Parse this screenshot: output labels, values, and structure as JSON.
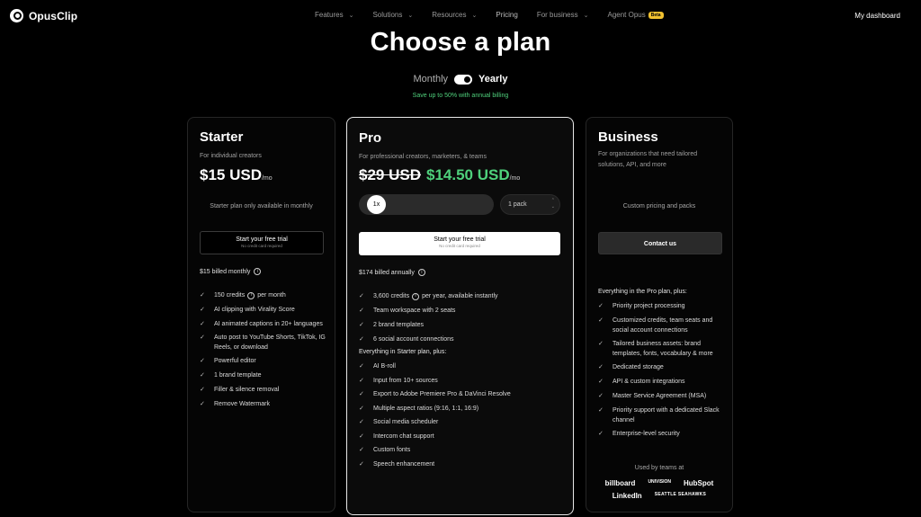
{
  "nav": {
    "logo_text": "OpusClip",
    "items": [
      {
        "label": "Features"
      },
      {
        "label": "Solutions"
      },
      {
        "label": "Resources"
      },
      {
        "label": "Pricing"
      },
      {
        "label": "For business"
      },
      {
        "label": "Agent Opus",
        "badge": "Beta"
      }
    ],
    "dashboard": "My dashboard"
  },
  "hero": {
    "title": "Choose a plan",
    "monthly": "Monthly",
    "yearly": "Yearly",
    "save_note": "Save up to 50% with annual billing"
  },
  "starter": {
    "name": "Starter",
    "subtitle": "For individual creators",
    "price": "$15 USD",
    "per": "/mo",
    "note": "Starter plan only available in monthly",
    "cta": "Start your free trial",
    "cta_sub": "No credit card required",
    "billed": "$15 billed monthly",
    "features": [
      "150 credits",
      "per month",
      "AI clipping with Virality Score",
      "AI animated captions in 20+ languages",
      "Auto post to YouTube Shorts, TikTok, IG Reels, or download",
      "Powerful editor",
      "1 brand template",
      "Filler & silence removal",
      "Remove Watermark"
    ]
  },
  "pro": {
    "name": "Pro",
    "subtitle": "For professional creators, marketers, & teams",
    "old_price": "$29 USD",
    "price": "$14.50 USD",
    "per": "/mo",
    "multiplier": "1x",
    "pack": "1 pack",
    "cta": "Start your free trial",
    "cta_sub": "No credit card required",
    "billed": "$174 billed annually",
    "features": [
      "3,600 credits",
      "per year, available instantly",
      "Team workspace with 2 seats",
      "2 brand templates",
      "6 social account connections"
    ],
    "plus_label": "Everything in Starter plan, plus:",
    "plus_features": [
      "AI B-roll",
      "Input from 10+ sources",
      "Export to Adobe Premiere Pro & DaVinci Resolve",
      "Multiple aspect ratios (9:16, 1:1, 16:9)",
      "Social media scheduler",
      "Intercom chat support",
      "Custom fonts",
      "Speech enhancement"
    ]
  },
  "business": {
    "name": "Business",
    "subtitle": "For organizations that need tailored solutions, API, and more",
    "note": "Custom pricing and packs",
    "cta": "Contact us",
    "plus_label": "Everything in the Pro plan, plus:",
    "features": [
      "Priority project processing",
      "Customized credits, team seats and social account connections",
      "Tailored business assets: brand templates, fonts, vocabulary & more",
      "Dedicated storage",
      "API & custom integrations",
      "Master Service Agreement (MSA)",
      "Priority support with a dedicated Slack channel",
      "Enterprise-level security"
    ],
    "used_by": "Used by teams at",
    "logos": [
      "billboard",
      "UNIVISION",
      "HubSpot",
      "LinkedIn",
      "SEATTLE SEAHAWKS"
    ]
  }
}
